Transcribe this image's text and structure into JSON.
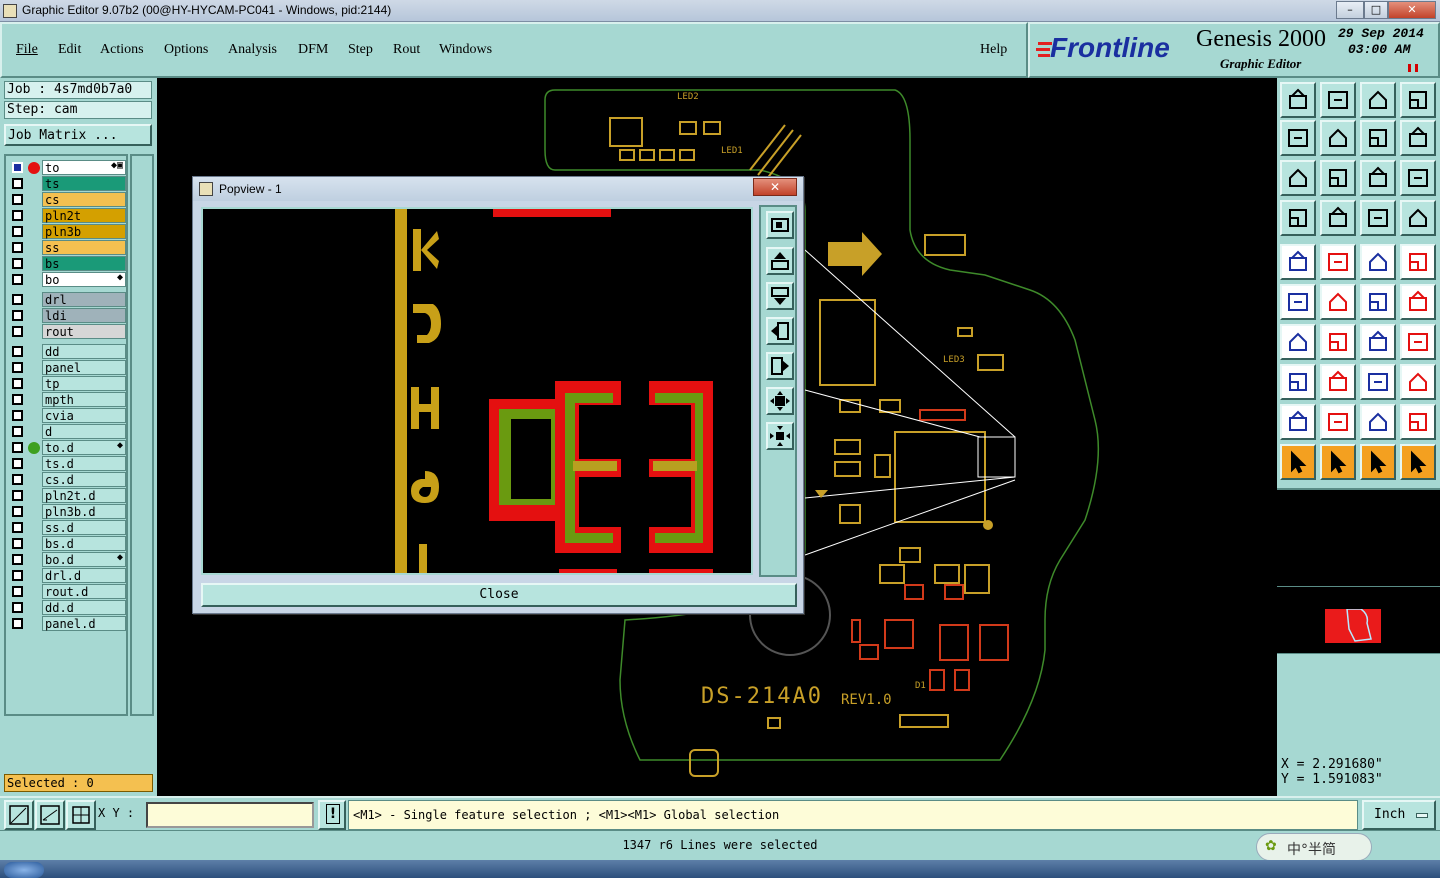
{
  "window": {
    "title": "Graphic Editor 9.07b2 (00@HY-HYCAM-PC041 - Windows, pid:2144)"
  },
  "menu": {
    "file": "File",
    "edit": "Edit",
    "actions": "Actions",
    "options": "Options",
    "analysis": "Analysis",
    "dfm": "DFM",
    "step": "Step",
    "rout": "Rout",
    "windows": "Windows",
    "help": "Help"
  },
  "brand": {
    "logo": "Frontline",
    "product": "Genesis 2000",
    "subtitle": "Graphic Editor",
    "date": "29 Sep 2014",
    "time": "03:00 AM"
  },
  "job": {
    "job": "Job : 4s7md0b7a0",
    "step": "Step: cam",
    "matrix": "Job Matrix ..."
  },
  "layers": [
    {
      "name": "to",
      "color": "#ffffff",
      "mark": "◆▣"
    },
    {
      "name": "ts",
      "color": "#1a9a78",
      "mark": ""
    },
    {
      "name": "cs",
      "color": "#f4c050",
      "mark": ""
    },
    {
      "name": "pln2t",
      "color": "#d4a000",
      "mark": ""
    },
    {
      "name": "pln3b",
      "color": "#d4a000",
      "mark": ""
    },
    {
      "name": "ss",
      "color": "#f4c050",
      "mark": ""
    },
    {
      "name": "bs",
      "color": "#1a9a78",
      "mark": ""
    },
    {
      "name": "bo",
      "color": "#ffffff",
      "mark": "◆"
    },
    {
      "name": "drl",
      "color": "#9fb2ba",
      "mark": ""
    },
    {
      "name": "ldi",
      "color": "#9fb2ba",
      "mark": ""
    },
    {
      "name": "rout",
      "color": "#d6d6d6",
      "mark": ""
    },
    {
      "name": "dd",
      "color": "#b7e4de",
      "mark": ""
    },
    {
      "name": "panel",
      "color": "#b7e4de",
      "mark": ""
    },
    {
      "name": "tp",
      "color": "#b7e4de",
      "mark": ""
    },
    {
      "name": "mpth",
      "color": "#b7e4de",
      "mark": ""
    },
    {
      "name": "cvia",
      "color": "#b7e4de",
      "mark": ""
    },
    {
      "name": "d",
      "color": "#b7e4de",
      "mark": ""
    },
    {
      "name": "to.d",
      "color": "#b7e4de",
      "mark": "◆"
    },
    {
      "name": "ts.d",
      "color": "#b7e4de",
      "mark": ""
    },
    {
      "name": "cs.d",
      "color": "#b7e4de",
      "mark": ""
    },
    {
      "name": "pln2t.d",
      "color": "#b7e4de",
      "mark": ""
    },
    {
      "name": "pln3b.d",
      "color": "#b7e4de",
      "mark": ""
    },
    {
      "name": "ss.d",
      "color": "#b7e4de",
      "mark": ""
    },
    {
      "name": "bs.d",
      "color": "#b7e4de",
      "mark": ""
    },
    {
      "name": "bo.d",
      "color": "#b7e4de",
      "mark": "◆"
    },
    {
      "name": "drl.d",
      "color": "#b7e4de",
      "mark": ""
    },
    {
      "name": "rout.d",
      "color": "#b7e4de",
      "mark": ""
    },
    {
      "name": "dd.d",
      "color": "#b7e4de",
      "mark": ""
    },
    {
      "name": "panel.d",
      "color": "#b7e4de",
      "mark": ""
    }
  ],
  "selected": "Selected : 0",
  "popview": {
    "title": "Popview - 1",
    "close": "Close"
  },
  "board": {
    "silk": "DS-214A0",
    "rev": "REV1.0",
    "led1": "LED1",
    "led2": "LED2",
    "led3": "LED3",
    "d1": "D1"
  },
  "coords": {
    "x": "X = 2.291680\"",
    "y": "Y = 1.591083\""
  },
  "bottom": {
    "xy_label": "X Y :",
    "xy_value": "",
    "hint": "<M1> - Single feature selection ; <M1><M1> Global selection",
    "unit": "Inch"
  },
  "status": "1347 r6 Lines were selected",
  "ime": "中°半简"
}
